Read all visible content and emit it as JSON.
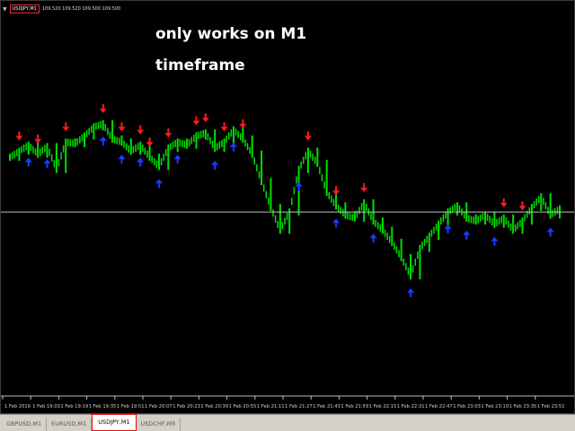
{
  "window": {
    "menu_glyph": "▼",
    "symbol": "USDJPY,M1",
    "ohlc": "109.520 109.520 109.500 109.500"
  },
  "annotation": {
    "line1": "only works on M1",
    "line2": "timeframe"
  },
  "time_axis": {
    "labels": [
      "1 Feb 2019",
      "1 Feb 19:03",
      "1 Feb 19:19",
      "1 Feb 19:35",
      "1 Feb 19:51",
      "1 Feb 20:07",
      "1 Feb 20:23",
      "1 Feb 20:39",
      "1 Feb 20:55",
      "1 Feb 21:11",
      "1 Feb 21:27",
      "1 Feb 21:43",
      "1 Feb 21:59",
      "1 Feb 22:15",
      "1 Feb 22:31",
      "1 Feb 22:47",
      "1 Feb 23:03",
      "1 Feb 23:19",
      "1 Feb 23:35",
      "1 Feb 23:51"
    ]
  },
  "tabs": [
    {
      "label": "GBPUSD,M1",
      "active": false
    },
    {
      "label": "EURUSD,M1",
      "active": false
    },
    {
      "label": "USDJPY,M1",
      "active": true
    },
    {
      "label": "USDCHF,M5",
      "active": false
    }
  ],
  "colors": {
    "background": "#000000",
    "candle": "#00e000",
    "sell_arrow": "#ff1a1a",
    "buy_arrow": "#1a3cff",
    "bid_line": "#c0c0c0",
    "highlight_box": "#e01010"
  },
  "chart_data": {
    "type": "line",
    "x": [
      "19:00",
      "19:05",
      "19:10",
      "19:15",
      "19:20",
      "19:25",
      "19:30",
      "19:35",
      "19:40",
      "19:45",
      "19:50",
      "19:55",
      "20:00",
      "20:05",
      "20:10",
      "20:15",
      "20:20",
      "20:25",
      "20:30",
      "20:35",
      "20:40",
      "20:45",
      "20:50",
      "20:55",
      "21:00",
      "21:05",
      "21:10",
      "21:15",
      "21:20",
      "21:25",
      "21:30",
      "21:35",
      "21:40",
      "21:45",
      "21:50",
      "21:55",
      "22:00",
      "22:05",
      "22:10",
      "22:15",
      "22:20",
      "22:25",
      "22:30",
      "22:35",
      "22:40",
      "22:45",
      "22:50",
      "22:55",
      "23:00",
      "23:05",
      "23:10",
      "23:15",
      "23:20",
      "23:25",
      "23:30",
      "23:35",
      "23:40",
      "23:45",
      "23:50",
      "23:55"
    ],
    "series": [
      {
        "values": [
          0.78,
          0.82,
          0.86,
          0.8,
          0.85,
          0.7,
          0.88,
          0.87,
          0.92,
          0.98,
          1.0,
          0.9,
          0.88,
          0.82,
          0.86,
          0.78,
          0.72,
          0.84,
          0.88,
          0.86,
          0.92,
          0.94,
          0.84,
          0.88,
          0.96,
          0.9,
          0.8,
          0.62,
          0.45,
          0.3,
          0.42,
          0.7,
          0.82,
          0.74,
          0.55,
          0.46,
          0.4,
          0.38,
          0.48,
          0.36,
          0.3,
          0.22,
          0.12,
          0.0,
          0.18,
          0.26,
          0.34,
          0.42,
          0.46,
          0.38,
          0.36,
          0.4,
          0.34,
          0.38,
          0.3,
          0.36,
          0.45,
          0.52,
          0.4,
          0.44
        ]
      }
    ],
    "signals": {
      "sell_x": [
        "19:05",
        "19:15",
        "19:30",
        "19:50",
        "20:00",
        "20:10",
        "20:15",
        "20:25",
        "20:40",
        "20:45",
        "20:55",
        "21:05",
        "21:40",
        "21:55",
        "22:10",
        "23:25",
        "23:35"
      ],
      "buy_x": [
        "19:10",
        "19:20",
        "19:50",
        "20:00",
        "20:10",
        "20:20",
        "20:30",
        "20:50",
        "21:00",
        "21:35",
        "21:55",
        "22:15",
        "22:35",
        "22:55",
        "23:05",
        "23:20",
        "23:50"
      ]
    },
    "bid_line_level": 0.42,
    "ylim": [
      -0.2,
      1.1
    ],
    "grid": false
  }
}
